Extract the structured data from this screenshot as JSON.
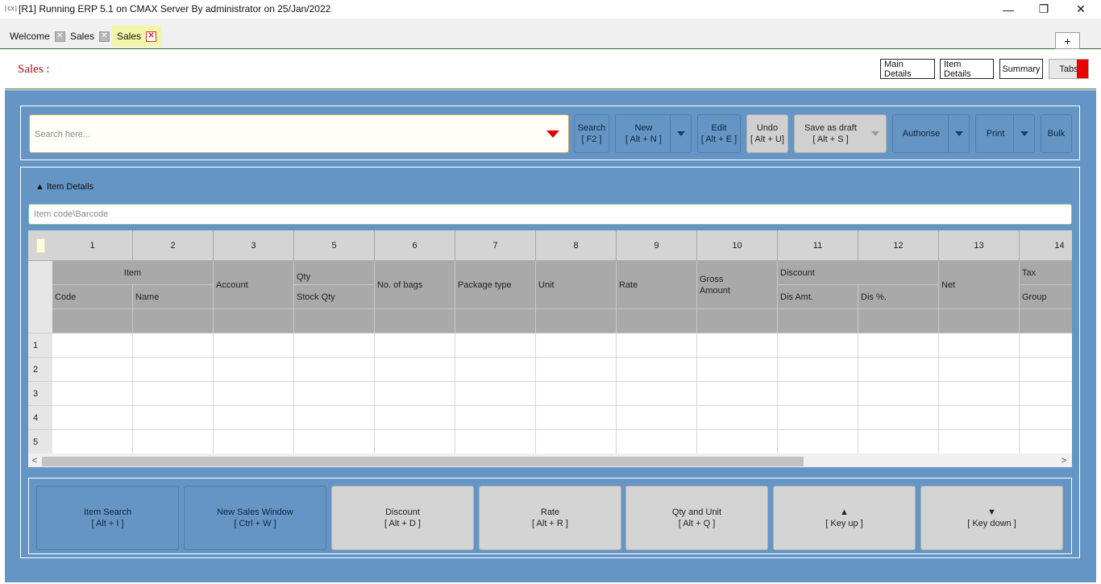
{
  "window": {
    "icon_text": "[CX]",
    "title": "[R1] Running ERP 5.1 on CMAX Server By administrator on 25/Jan/2022",
    "controls": {
      "minimize": "—",
      "restore": "❐",
      "close": "✕"
    }
  },
  "tabs": [
    {
      "label": "Welcome",
      "close": "✕"
    },
    {
      "label": "Sales",
      "close": "✕"
    },
    {
      "label": "Sales",
      "close": "✕",
      "active": true
    }
  ],
  "add_tab": "+",
  "header": {
    "title": "Sales :",
    "buttons": {
      "main_details": "Main Details",
      "item_details": "Item Details",
      "summary": "Summary",
      "tabs": "Tabs"
    }
  },
  "toolbar": {
    "search_placeholder": "Search here...",
    "search": {
      "line1": "Search",
      "line2": "[ F2 ]"
    },
    "new": {
      "line1": "New",
      "line2": "[ Alt + N ]"
    },
    "edit": {
      "line1": "Edit",
      "line2": "[ Alt + E ]"
    },
    "undo": {
      "line1": "Undo",
      "line2": "[ Alt + U]"
    },
    "save_draft": {
      "line1": "Save as draft",
      "line2": "[ Alt + S ]"
    },
    "authorise": "Authorise",
    "print": "Print",
    "bulk": "Bulk"
  },
  "item_section": {
    "toggle": "▲ Item Details",
    "item_code_placeholder": "Item code\\Barcode"
  },
  "grid": {
    "column_numbers": [
      "1",
      "2",
      "3",
      "5",
      "6",
      "7",
      "8",
      "9",
      "10",
      "11",
      "12",
      "13",
      "14"
    ],
    "groups": {
      "item": "Item",
      "qty": "Qty",
      "discount": "Discount",
      "tax": "Tax"
    },
    "headers": {
      "code": "Code",
      "name": "Name",
      "account": "Account",
      "stock_qty": "Stock Qty",
      "no_of_bags": "No. of bags",
      "package_type": "Package type",
      "unit": "Unit",
      "rate": "Rate",
      "gross_amount": "Gross\nAmount",
      "dis_amt": "Dis Amt.",
      "dis_pct": "Dis %.",
      "net": "Net",
      "group": "Group"
    },
    "row_numbers": [
      "1",
      "2",
      "3",
      "4",
      "5"
    ]
  },
  "scroll": {
    "left": "<",
    "right": ">"
  },
  "shortcuts": [
    {
      "line1": "Item Search",
      "line2": "[ Alt + I ]",
      "style": "blue"
    },
    {
      "line1": "New Sales Window",
      "line2": "[ Ctrl + W ]",
      "style": "blue"
    },
    {
      "line1": "Discount",
      "line2": "[ Alt + D ]",
      "style": "grey"
    },
    {
      "line1": "Rate",
      "line2": "[ Alt + R ]",
      "style": "grey"
    },
    {
      "line1": "Qty and Unit",
      "line2": "[ Alt + Q ]",
      "style": "grey"
    },
    {
      "line1": "▲",
      "line2": "[ Key up ]",
      "style": "grey"
    },
    {
      "line1": "▼",
      "line2": "[ Key down ]",
      "style": "grey"
    }
  ],
  "colors": {
    "main_bg": "#6595c4",
    "title_red": "#a01010",
    "active_tab": "#f3f6a8",
    "accent_red": "#ee0000"
  }
}
